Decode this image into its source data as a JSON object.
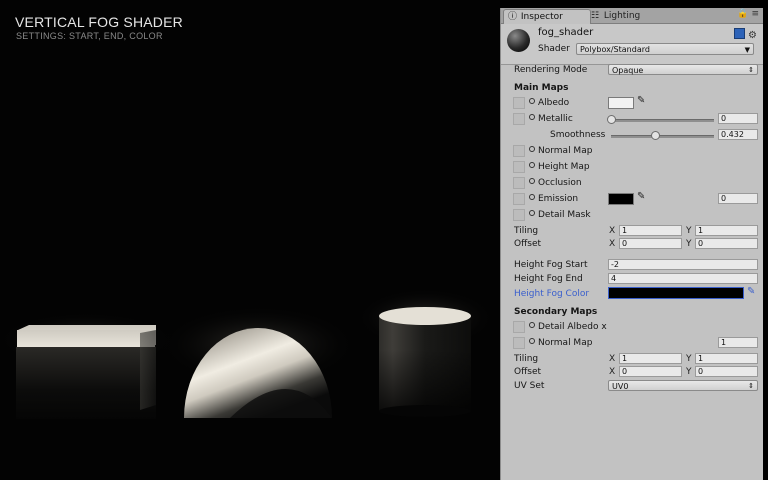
{
  "scene": {
    "title": "VERTICAL FOG SHADER",
    "subtitle": "SETTINGS: START, END, COLOR"
  },
  "inspector": {
    "tabs": [
      {
        "label": "Inspector",
        "icon": "info-icon"
      },
      {
        "label": "Lighting",
        "icon": "lighting-icon"
      }
    ],
    "material_name": "fog_shader",
    "shader_label": "Shader",
    "shader_value": "Polybox/Standard",
    "rendering_mode_label": "Rendering Mode",
    "rendering_mode_value": "Opaque",
    "main_maps_title": "Main Maps",
    "albedo_label": "Albedo",
    "metallic_label": "Metallic",
    "metallic_value": "0",
    "metallic_level": 0,
    "smoothness_label": "Smoothness",
    "smoothness_value": "0.432",
    "smoothness_level": 0.432,
    "normal_map_label": "Normal Map",
    "height_map_label": "Height Map",
    "occlusion_label": "Occlusion",
    "emission_label": "Emission",
    "emission_value": "0",
    "detail_mask_label": "Detail Mask",
    "tiling_label": "Tiling",
    "tiling_x": "1",
    "tiling_y": "1",
    "offset_label": "Offset",
    "offset_x": "0",
    "offset_y": "0",
    "x_axis": "X",
    "y_axis": "Y",
    "height_fog_start_label": "Height Fog Start",
    "height_fog_start_value": "-2",
    "height_fog_end_label": "Height Fog End",
    "height_fog_end_value": "4",
    "height_fog_color_label": "Height Fog Color",
    "height_fog_color": "#000000",
    "secondary_maps_title": "Secondary Maps",
    "detail_albedo_label": "Detail Albedo x",
    "secondary_normal_label": "Normal Map",
    "secondary_normal_value": "1",
    "sec_tiling_x": "1",
    "sec_tiling_y": "1",
    "sec_offset_x": "0",
    "sec_offset_y": "0",
    "uv_set_label": "UV Set",
    "uv_set_value": "UV0"
  },
  "colors": {
    "albedo": "#f2f2f2",
    "emission": "#000000",
    "accent_blue": "#3a5fcd"
  }
}
